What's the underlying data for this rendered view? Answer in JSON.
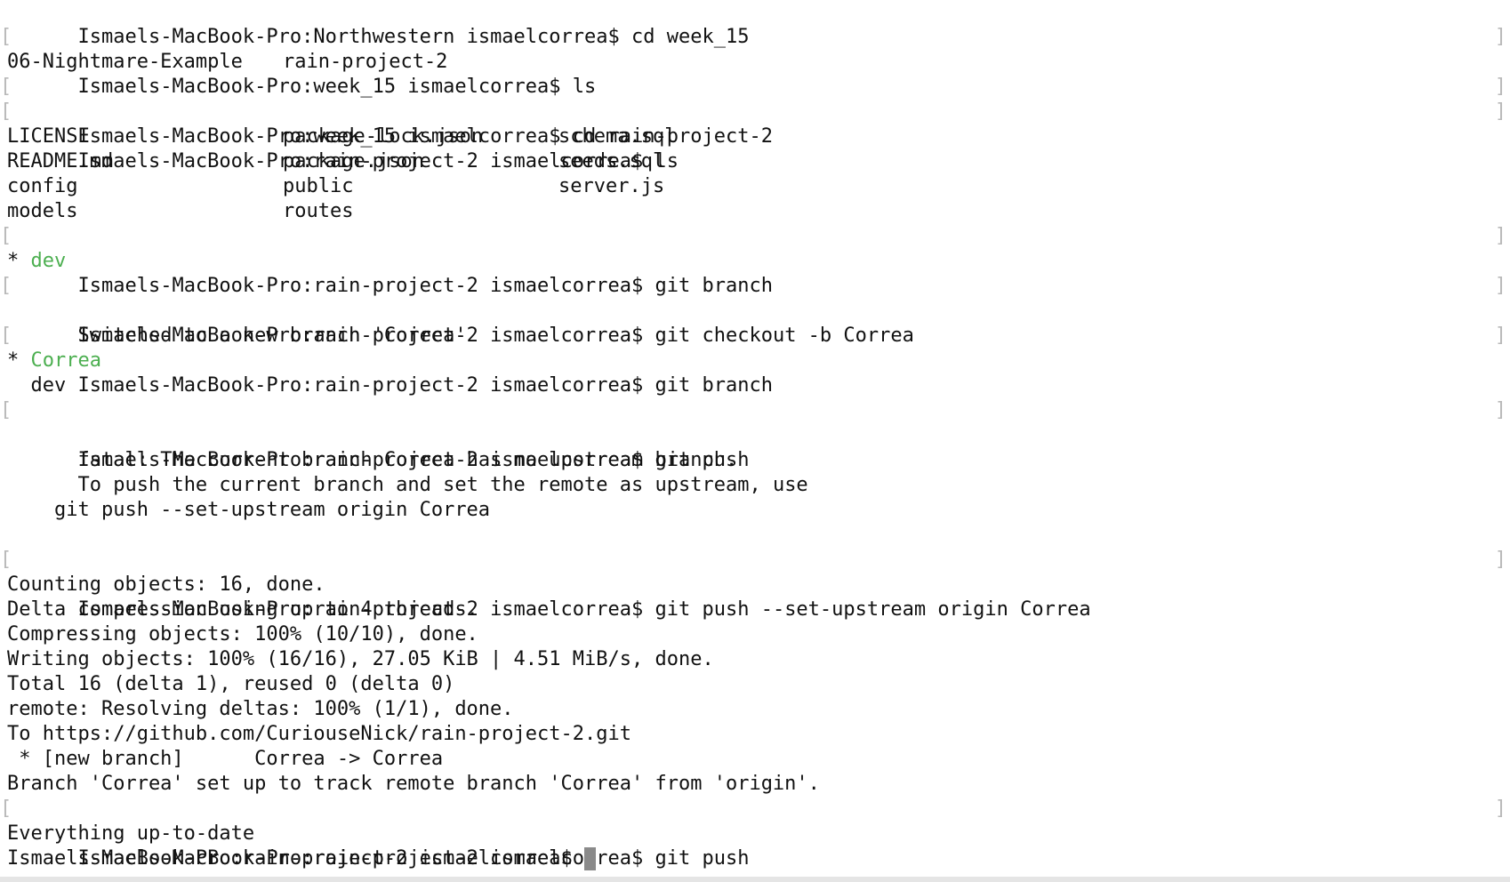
{
  "terminal": {
    "brackets": {
      "left": "[",
      "right": "]"
    },
    "colors": {
      "text": "#111111",
      "branch_highlight": "#4caf50",
      "marker": "#b9b9b9",
      "cursor": "#8a8a8a"
    },
    "lines": {
      "l01": "Ismaels-MacBook-Pro:Northwestern ismaelcorrea$ cd week_15",
      "l02": "Ismaels-MacBook-Pro:week_15 ismaelcorrea$ ls",
      "l03a": "06-Nightmare-Example",
      "l03b": "rain-project-2",
      "l04": "Ismaels-MacBook-Pro:week_15 ismaelcorrea$ cd rain-project-2",
      "l05": "Ismaels-MacBook-Pro:rain-project-2 ismaelcorrea$ ls",
      "ls_rows": [
        [
          "LICENSE",
          "package-lock.json",
          "schema.sql"
        ],
        [
          "README.md",
          "package.json",
          "seeds.sql"
        ],
        [
          "config",
          "public",
          "server.js"
        ],
        [
          "models",
          "routes",
          ""
        ]
      ],
      "l10": "Ismaels-MacBook-Pro:rain-project-2 ismaelcorrea$ git branch",
      "l11_star": "* ",
      "l11_branch": "dev",
      "l12": "Ismaels-MacBook-Pro:rain-project-2 ismaelcorrea$ git checkout -b Correa",
      "l13": "Switched to a new branch 'Correa'",
      "l14": "Ismaels-MacBook-Pro:rain-project-2 ismaelcorrea$ git branch",
      "l15_star": "* ",
      "l15_branch": "Correa",
      "l16": "  dev",
      "l17": "Ismaels-MacBook-Pro:rain-project-2 ismaelcorrea$ git push",
      "l18": "fatal: The current branch Correa has no upstream branch.",
      "l19": "To push the current branch and set the remote as upstream, use",
      "l21": "    git push --set-upstream origin Correa",
      "l23": "Ismaels-MacBook-Pro:rain-project-2 ismaelcorrea$ git push --set-upstream origin Correa",
      "l24": "Counting objects: 16, done.",
      "l25": "Delta compression using up to 4 threads.",
      "l26": "Compressing objects: 100% (10/10), done.",
      "l27": "Writing objects: 100% (16/16), 27.05 KiB | 4.51 MiB/s, done.",
      "l28": "Total 16 (delta 1), reused 0 (delta 0)",
      "l29": "remote: Resolving deltas: 100% (1/1), done.",
      "l30": "To https://github.com/CuriouseNick/rain-project-2.git",
      "l31": " * [new branch]      Correa -> Correa",
      "l32": "Branch 'Correa' set up to track remote branch 'Correa' from 'origin'.",
      "l33": "Ismaels-MacBook-Pro:rain-project-2 ismaelcorrea$ git push",
      "l34": "Everything up-to-date",
      "l35": "Ismaels-MacBook-Pro:rain-project-2 ismaelcorrea$"
    }
  }
}
